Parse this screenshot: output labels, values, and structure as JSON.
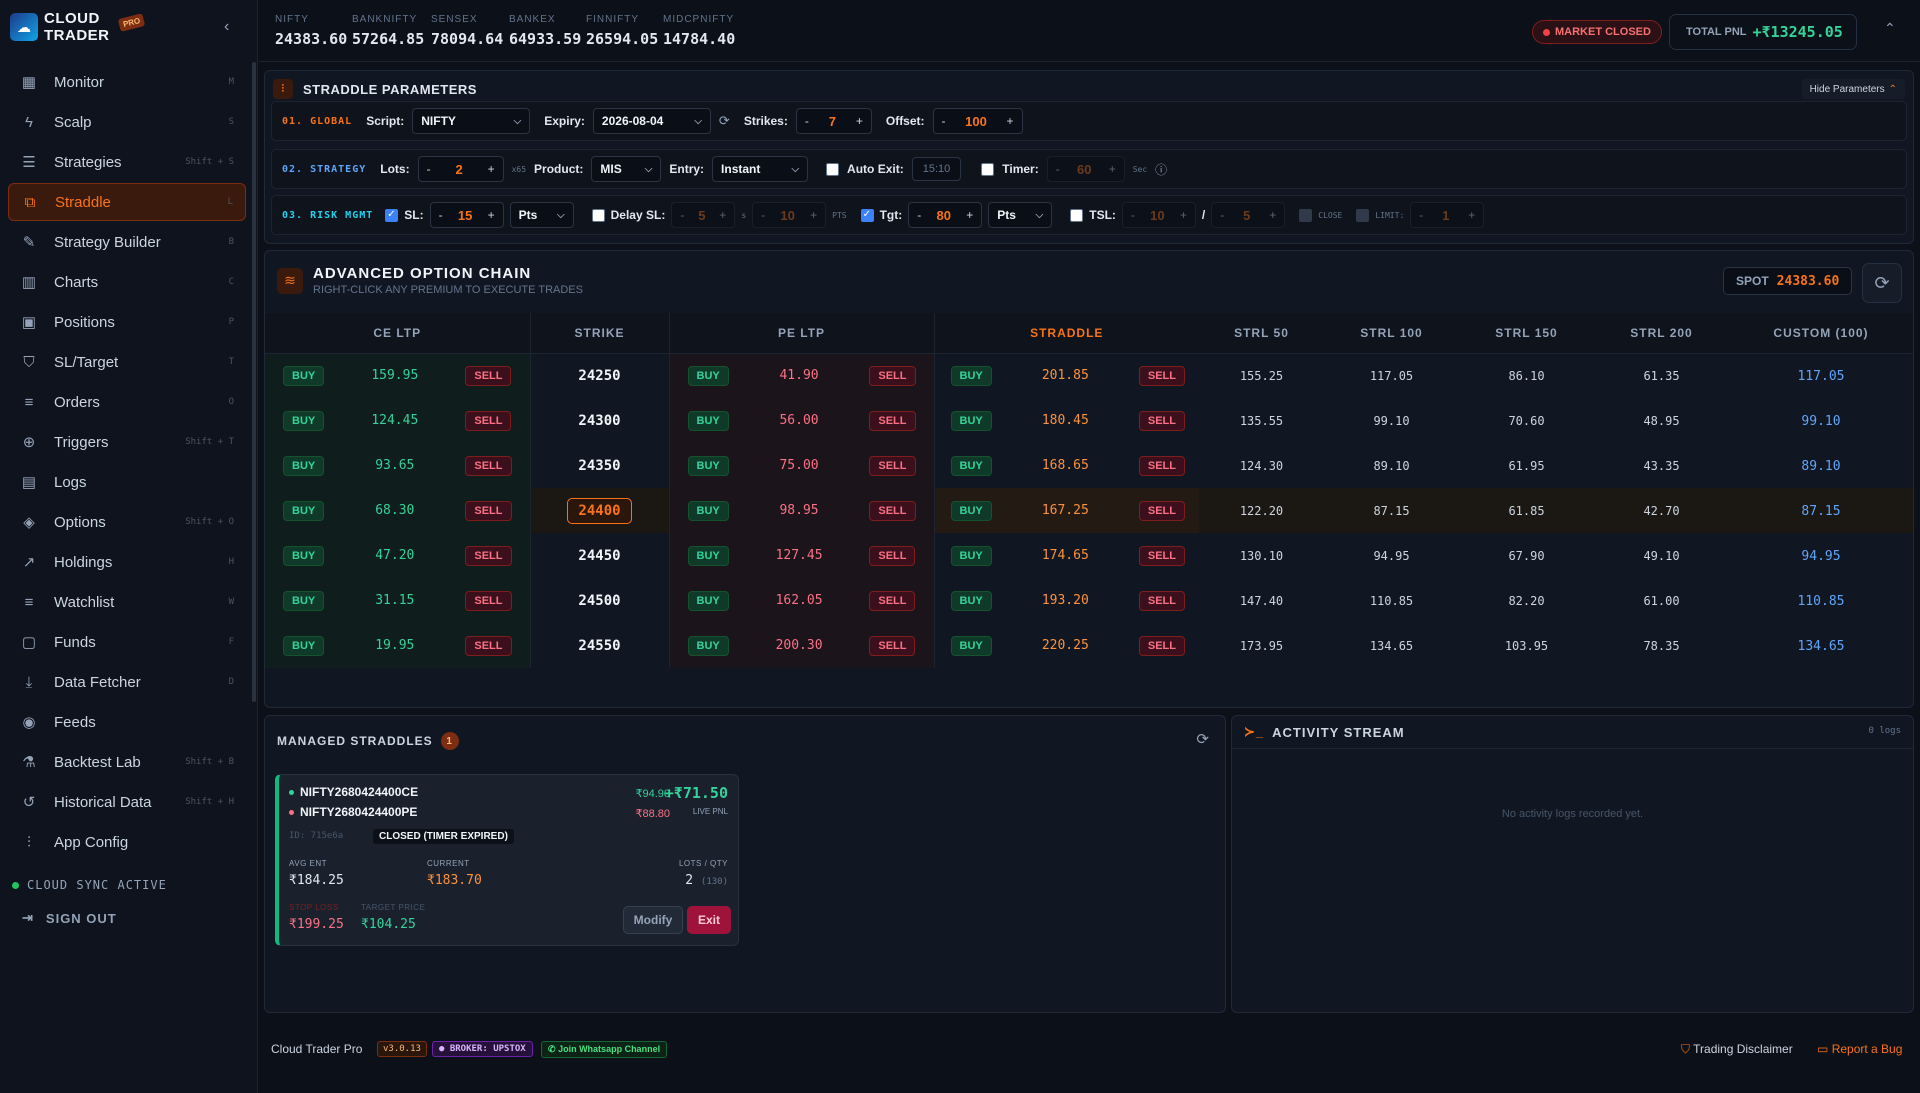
{
  "brand": {
    "line1": "CLOUD",
    "line2": "TRADER",
    "badge": "PRO"
  },
  "nav": [
    {
      "label": "Monitor",
      "shortcut": "M",
      "icon": "grid-icon"
    },
    {
      "label": "Scalp",
      "shortcut": "S",
      "icon": "bolt-icon"
    },
    {
      "label": "Strategies",
      "shortcut": "Shift + S",
      "icon": "stack-icon"
    },
    {
      "label": "Straddle",
      "shortcut": "L",
      "icon": "straddle-icon",
      "active": true
    },
    {
      "label": "Strategy Builder",
      "shortcut": "B",
      "icon": "wrench-icon"
    },
    {
      "label": "Charts",
      "shortcut": "C",
      "icon": "chart-icon"
    },
    {
      "label": "Positions",
      "shortcut": "P",
      "icon": "briefcase-icon"
    },
    {
      "label": "SL/Target",
      "shortcut": "T",
      "icon": "shield-icon"
    },
    {
      "label": "Orders",
      "shortcut": "O",
      "icon": "list-icon"
    },
    {
      "label": "Triggers",
      "shortcut": "Shift + T",
      "icon": "crosshair-icon"
    },
    {
      "label": "Logs",
      "shortcut": "",
      "icon": "document-icon"
    },
    {
      "label": "Options",
      "shortcut": "Shift + O",
      "icon": "layers-icon"
    },
    {
      "label": "Holdings",
      "shortcut": "H",
      "icon": "trend-icon"
    },
    {
      "label": "Watchlist",
      "shortcut": "W",
      "icon": "list-icon"
    },
    {
      "label": "Funds",
      "shortcut": "F",
      "icon": "wallet-icon"
    },
    {
      "label": "Data Fetcher",
      "shortcut": "D",
      "icon": "download-icon"
    },
    {
      "label": "Feeds",
      "shortcut": "",
      "icon": "radio-icon"
    },
    {
      "label": "Backtest Lab",
      "shortcut": "Shift + B",
      "icon": "flask-icon"
    },
    {
      "label": "Historical Data",
      "shortcut": "Shift + H",
      "icon": "history-icon"
    },
    {
      "label": "App Config",
      "shortcut": "",
      "icon": "sliders-icon"
    }
  ],
  "sidebar": {
    "sync": "CLOUD SYNC ACTIVE",
    "signout": "SIGN OUT"
  },
  "indices": [
    {
      "name": "NIFTY",
      "value": "24383.60"
    },
    {
      "name": "BANKNIFTY",
      "value": "57264.85"
    },
    {
      "name": "SENSEX",
      "value": "78094.64"
    },
    {
      "name": "BANKEX",
      "value": "64933.59"
    },
    {
      "name": "FINNIFTY",
      "value": "26594.05"
    },
    {
      "name": "MIDCPNIFTY",
      "value": "14784.40"
    }
  ],
  "topbar": {
    "market_status": "MARKET CLOSED",
    "pnl_label": "TOTAL PNL",
    "pnl_value": "+₹13245.05"
  },
  "params": {
    "title": "STRADDLE PARAMETERS",
    "hide": "Hide Parameters",
    "global": {
      "label": "01. GLOBAL",
      "script_label": "Script:",
      "script": "NIFTY",
      "expiry_label": "Expiry:",
      "expiry": "2026-08-04",
      "strikes_label": "Strikes:",
      "strikes": "7",
      "offset_label": "Offset:",
      "offset": "100"
    },
    "strategy": {
      "label": "02. STRATEGY",
      "lots_label": "Lots:",
      "lots": "2",
      "multiplier": "x65",
      "product_label": "Product:",
      "product": "MIS",
      "entry_label": "Entry:",
      "entry": "Instant",
      "autoexit_label": "Auto Exit:",
      "autoexit_time": "15:10",
      "timer_label": "Timer:",
      "timer": "60",
      "sec": "Sec"
    },
    "risk": {
      "label": "03. RISK MGMT",
      "sl_label": "SL:",
      "sl": "15",
      "sl_unit": "Pts",
      "delay_label": "Delay SL:",
      "delay1": "5",
      "delay_unit1": "s",
      "delay2": "10",
      "delay_unit2": "PTS",
      "tgt_label": "Tgt:",
      "tgt": "80",
      "tgt_unit": "Pts",
      "tsl_label": "TSL:",
      "tsl1": "10",
      "tsl_sep": "/",
      "tsl2": "5",
      "close_label": "CLOSE",
      "limit_label": "LIMIT:",
      "limit": "1"
    }
  },
  "chain": {
    "title": "ADVANCED OPTION CHAIN",
    "subtitle": "RIGHT-CLICK ANY PREMIUM TO EXECUTE TRADES",
    "spot_label": "SPOT",
    "spot": "24383.60",
    "headers": [
      "CE LTP",
      "STRIKE",
      "PE LTP",
      "STRADDLE",
      "STRL 50",
      "STRL 100",
      "STRL 150",
      "STRL 200",
      "CUSTOM (100)"
    ],
    "buy": "BUY",
    "sell": "SELL",
    "rows": [
      {
        "ce": "159.95",
        "strike": "24250",
        "pe": "41.90",
        "straddle": "201.85",
        "s50": "155.25",
        "s100": "117.05",
        "s150": "86.10",
        "s200": "61.35",
        "custom": "117.05"
      },
      {
        "ce": "124.45",
        "strike": "24300",
        "pe": "56.00",
        "straddle": "180.45",
        "s50": "135.55",
        "s100": "99.10",
        "s150": "70.60",
        "s200": "48.95",
        "custom": "99.10"
      },
      {
        "ce": "93.65",
        "strike": "24350",
        "pe": "75.00",
        "straddle": "168.65",
        "s50": "124.30",
        "s100": "89.10",
        "s150": "61.95",
        "s200": "43.35",
        "custom": "89.10"
      },
      {
        "ce": "68.30",
        "strike": "24400",
        "pe": "98.95",
        "straddle": "167.25",
        "s50": "122.20",
        "s100": "87.15",
        "s150": "61.85",
        "s200": "42.70",
        "custom": "87.15",
        "atm": true
      },
      {
        "ce": "47.20",
        "strike": "24450",
        "pe": "127.45",
        "straddle": "174.65",
        "s50": "130.10",
        "s100": "94.95",
        "s150": "67.90",
        "s200": "49.10",
        "custom": "94.95"
      },
      {
        "ce": "31.15",
        "strike": "24500",
        "pe": "162.05",
        "straddle": "193.20",
        "s50": "147.40",
        "s100": "110.85",
        "s150": "82.20",
        "s200": "61.00",
        "custom": "110.85"
      },
      {
        "ce": "19.95",
        "strike": "24550",
        "pe": "200.30",
        "straddle": "220.25",
        "s50": "173.95",
        "s100": "134.65",
        "s150": "103.95",
        "s200": "78.35",
        "custom": "134.65"
      }
    ]
  },
  "managed": {
    "title": "MANAGED STRADDLES",
    "count": "1",
    "card": {
      "ce_symbol": "NIFTY2680424400CE",
      "pe_symbol": "NIFTY2680424400PE",
      "ce_price": "₹94.90",
      "pe_price": "₹88.80",
      "live_pnl": "+₹71.50",
      "live_label": "LIVE PNL",
      "id": "ID: 715e6a",
      "status": "CLOSED (TIMER EXPIRED)",
      "avg_label": "AVG ENT",
      "avg": "₹184.25",
      "current_label": "CURRENT",
      "current": "₹183.70",
      "lots_label": "LOTS / QTY",
      "lots": "2",
      "qty": "(130)",
      "sl_label": "STOP LOSS",
      "sl": "₹199.25",
      "tp_label": "TARGET PRICE",
      "tp": "₹104.25",
      "modify": "Modify",
      "exit": "Exit"
    }
  },
  "activity": {
    "title": "ACTIVITY STREAM",
    "count": "0 logs",
    "empty": "No activity logs recorded yet."
  },
  "footer": {
    "app": "Cloud Trader Pro",
    "version": "v3.0.13",
    "broker": "BROKER: UPSTOX",
    "whatsapp": "Join Whatsapp Channel",
    "disclaimer": "Trading Disclaimer",
    "bug": "Report a Bug"
  },
  "colors": {
    "accent": "#f97316",
    "buy": "#34d399",
    "sell": "#fb7185",
    "custom": "#60a5fa"
  }
}
